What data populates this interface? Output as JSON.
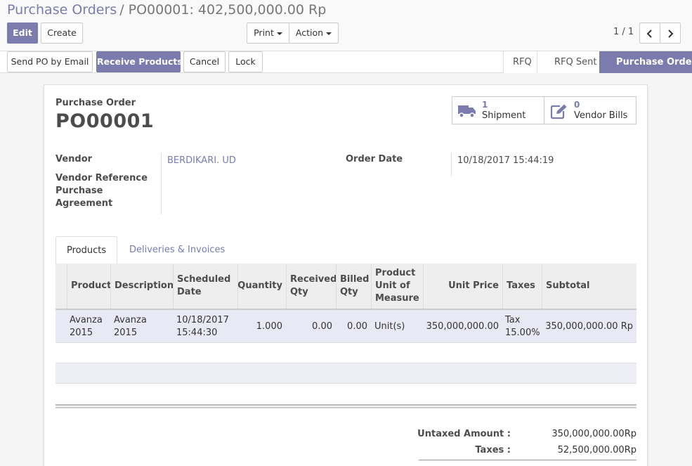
{
  "breadcrumb": {
    "parent": "Purchase Orders",
    "separator": "/",
    "current": "PO00001: 402,500,000.00 Rp"
  },
  "toolbar": {
    "edit": "Edit",
    "create": "Create",
    "print": "Print",
    "action": "Action"
  },
  "pager": {
    "value": "1 / 1"
  },
  "statusbar": {
    "send_email": "Send PO by Email",
    "receive": "Receive Products",
    "cancel": "Cancel",
    "lock": "Lock",
    "stages": [
      "RFQ",
      "RFQ Sent",
      "Purchase Order"
    ],
    "active_stage": "Purchase Order"
  },
  "sheet": {
    "doc_label": "Purchase Order",
    "name": "PO00001",
    "smart_buttons": [
      {
        "count": "1",
        "label": "Shipment",
        "icon": "truck-icon"
      },
      {
        "count": "0",
        "label": "Vendor Bills",
        "icon": "pencil-square-icon"
      }
    ],
    "fields": {
      "vendor_label": "Vendor",
      "vendor_value": "BERDIKARI. UD",
      "vendor_ref_label": "Vendor Reference",
      "agreement_label_1": "Purchase",
      "agreement_label_2": "Agreement",
      "order_date_label": "Order Date",
      "order_date_value": "10/18/2017 15:44:19"
    },
    "tabs": [
      "Products",
      "Deliveries & Invoices"
    ],
    "table": {
      "headers": {
        "product": "Product",
        "description": "Description",
        "scheduled_1": "Scheduled",
        "scheduled_2": "Date",
        "quantity": "Quantity",
        "received_1": "Received",
        "received_2": "Qty",
        "billed_1": "Billed",
        "billed_2": "Qty",
        "uom_1": "Product",
        "uom_2": "Unit of",
        "uom_3": "Measure",
        "unit_price": "Unit Price",
        "taxes": "Taxes",
        "subtotal": "Subtotal"
      },
      "rows": [
        {
          "product_1": "Avanza",
          "product_2": "2015",
          "description_1": "Avanza",
          "description_2": "2015",
          "date_1": "10/18/2017",
          "date_2": "15:44:30",
          "quantity": "1.000",
          "received": "0.00",
          "billed": "0.00",
          "uom": "Unit(s)",
          "unit_price": "350,000,000.00",
          "tax_1": "Tax",
          "tax_2": "15.00%",
          "subtotal": "350,000,000.00 Rp"
        }
      ]
    },
    "totals": {
      "untaxed_label": "Untaxed Amount :",
      "untaxed_value": "350,000,000.00Rp",
      "taxes_label": "Taxes :",
      "taxes_value": "52,500,000.00Rp"
    }
  },
  "colors": {
    "brand": "#7c7bad",
    "row_highlight": "#e9e9f5"
  }
}
